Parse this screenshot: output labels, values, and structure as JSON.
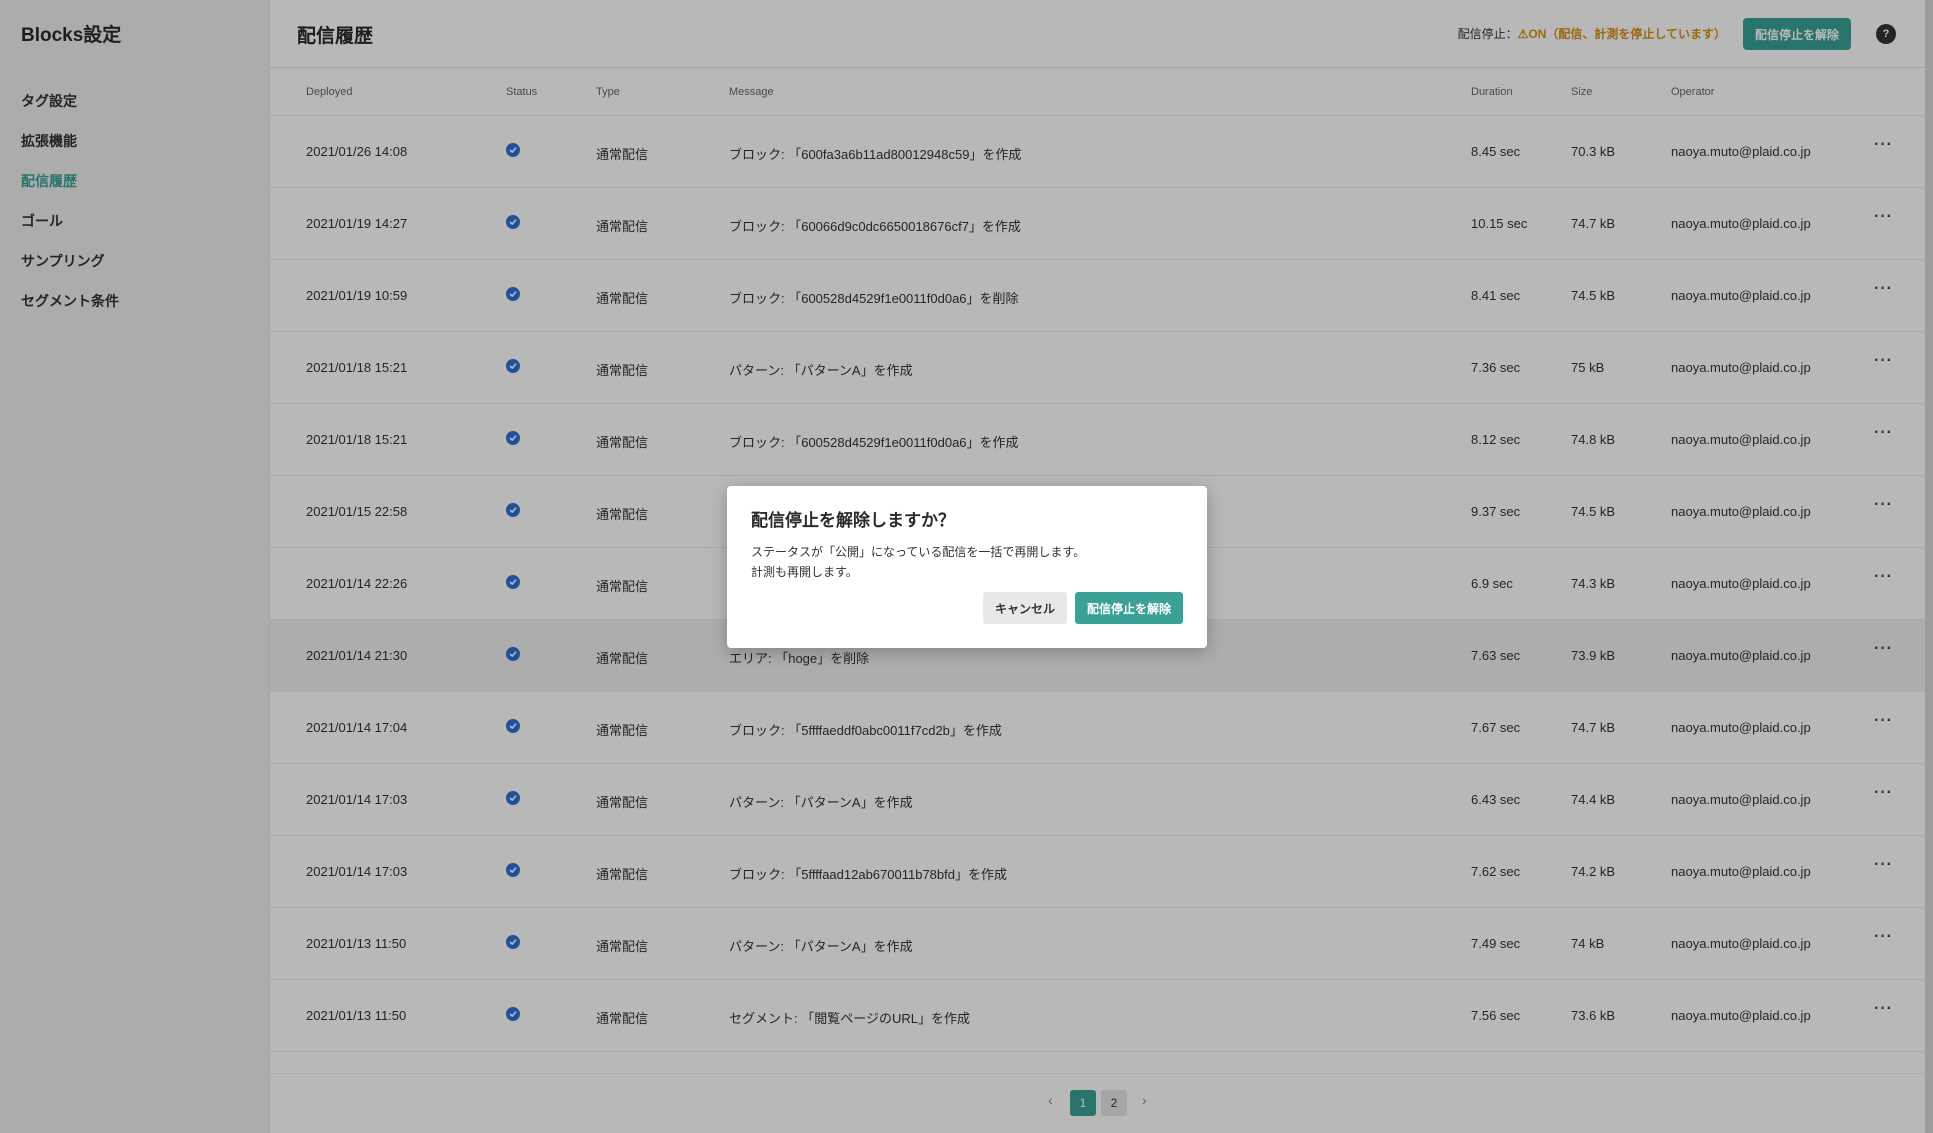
{
  "sidebar": {
    "brand": "Blocks設定",
    "items": [
      {
        "label": "タグ設定",
        "active": false
      },
      {
        "label": "拡張機能",
        "active": false
      },
      {
        "label": "配信履歴",
        "active": true
      },
      {
        "label": "ゴール",
        "active": false
      },
      {
        "label": "サンプリング",
        "active": false
      },
      {
        "label": "セグメント条件",
        "active": false
      }
    ]
  },
  "header": {
    "title": "配信履歴",
    "stop_label": "配信停止：",
    "stop_value": "ON（配信、計測を停止しています）",
    "release_button": "配信停止を解除",
    "help_icon": "help-icon"
  },
  "table": {
    "columns": {
      "deployed": "Deployed",
      "status": "Status",
      "type": "Type",
      "message": "Message",
      "duration": "Duration",
      "size": "Size",
      "operator": "Operator"
    },
    "rows": [
      {
        "deployed": "2021/01/26 14:08",
        "type": "通常配信",
        "message": "ブロック: 「600fa3a6b11ad80012948c59」を作成",
        "duration": "8.45 sec",
        "size": "70.3 kB",
        "operator": "naoya.muto@plaid.co.jp"
      },
      {
        "deployed": "2021/01/19 14:27",
        "type": "通常配信",
        "message": "ブロック: 「60066d9c0dc6650018676cf7」を作成",
        "duration": "10.15 sec",
        "size": "74.7 kB",
        "operator": "naoya.muto@plaid.co.jp"
      },
      {
        "deployed": "2021/01/19 10:59",
        "type": "通常配信",
        "message": "ブロック: 「600528d4529f1e0011f0d0a6」を削除",
        "duration": "8.41 sec",
        "size": "74.5 kB",
        "operator": "naoya.muto@plaid.co.jp"
      },
      {
        "deployed": "2021/01/18 15:21",
        "type": "通常配信",
        "message": "パターン: 「パターンA」を作成",
        "duration": "7.36 sec",
        "size": "75 kB",
        "operator": "naoya.muto@plaid.co.jp"
      },
      {
        "deployed": "2021/01/18 15:21",
        "type": "通常配信",
        "message": "ブロック: 「600528d4529f1e0011f0d0a6」を作成",
        "duration": "8.12 sec",
        "size": "74.8 kB",
        "operator": "naoya.muto@plaid.co.jp"
      },
      {
        "deployed": "2021/01/15 22:58",
        "type": "通常配信",
        "message": "",
        "duration": "9.37 sec",
        "size": "74.5 kB",
        "operator": "naoya.muto@plaid.co.jp"
      },
      {
        "deployed": "2021/01/14 22:26",
        "type": "通常配信",
        "message": "",
        "duration": "6.9 sec",
        "size": "74.3 kB",
        "operator": "naoya.muto@plaid.co.jp"
      },
      {
        "deployed": "2021/01/14 21:30",
        "type": "通常配信",
        "message": "エリア: 「hoge」を削除",
        "duration": "7.63 sec",
        "size": "73.9 kB",
        "operator": "naoya.muto@plaid.co.jp"
      },
      {
        "deployed": "2021/01/14 17:04",
        "type": "通常配信",
        "message": "ブロック: 「5ffffaeddf0abc0011f7cd2b」を作成",
        "duration": "7.67 sec",
        "size": "74.7 kB",
        "operator": "naoya.muto@plaid.co.jp"
      },
      {
        "deployed": "2021/01/14 17:03",
        "type": "通常配信",
        "message": "パターン: 「パターンA」を作成",
        "duration": "6.43 sec",
        "size": "74.4 kB",
        "operator": "naoya.muto@plaid.co.jp"
      },
      {
        "deployed": "2021/01/14 17:03",
        "type": "通常配信",
        "message": "ブロック: 「5ffffaad12ab670011b78bfd」を作成",
        "duration": "7.62 sec",
        "size": "74.2 kB",
        "operator": "naoya.muto@plaid.co.jp"
      },
      {
        "deployed": "2021/01/13 11:50",
        "type": "通常配信",
        "message": "パターン: 「パターンA」を作成",
        "duration": "7.49 sec",
        "size": "74 kB",
        "operator": "naoya.muto@plaid.co.jp"
      },
      {
        "deployed": "2021/01/13 11:50",
        "type": "通常配信",
        "message": "セグメント: 「閲覧ページのURL」を作成",
        "duration": "7.56 sec",
        "size": "73.6 kB",
        "operator": "naoya.muto@plaid.co.jp"
      }
    ],
    "highlighted_row": 7
  },
  "pagination": {
    "prev": "‹",
    "pages": [
      "1",
      "2"
    ],
    "current": "1",
    "next": "›"
  },
  "modal": {
    "title": "配信停止を解除しますか？",
    "body_line1": "ステータスが「公開」になっている配信を一括で再開します。",
    "body_line2": "計測も再開します。",
    "cancel": "キャンセル",
    "confirm": "配信停止を解除"
  },
  "colors": {
    "accent": "#3aa196",
    "status_icon": "#2f6fd6",
    "warning": "#d99016"
  }
}
